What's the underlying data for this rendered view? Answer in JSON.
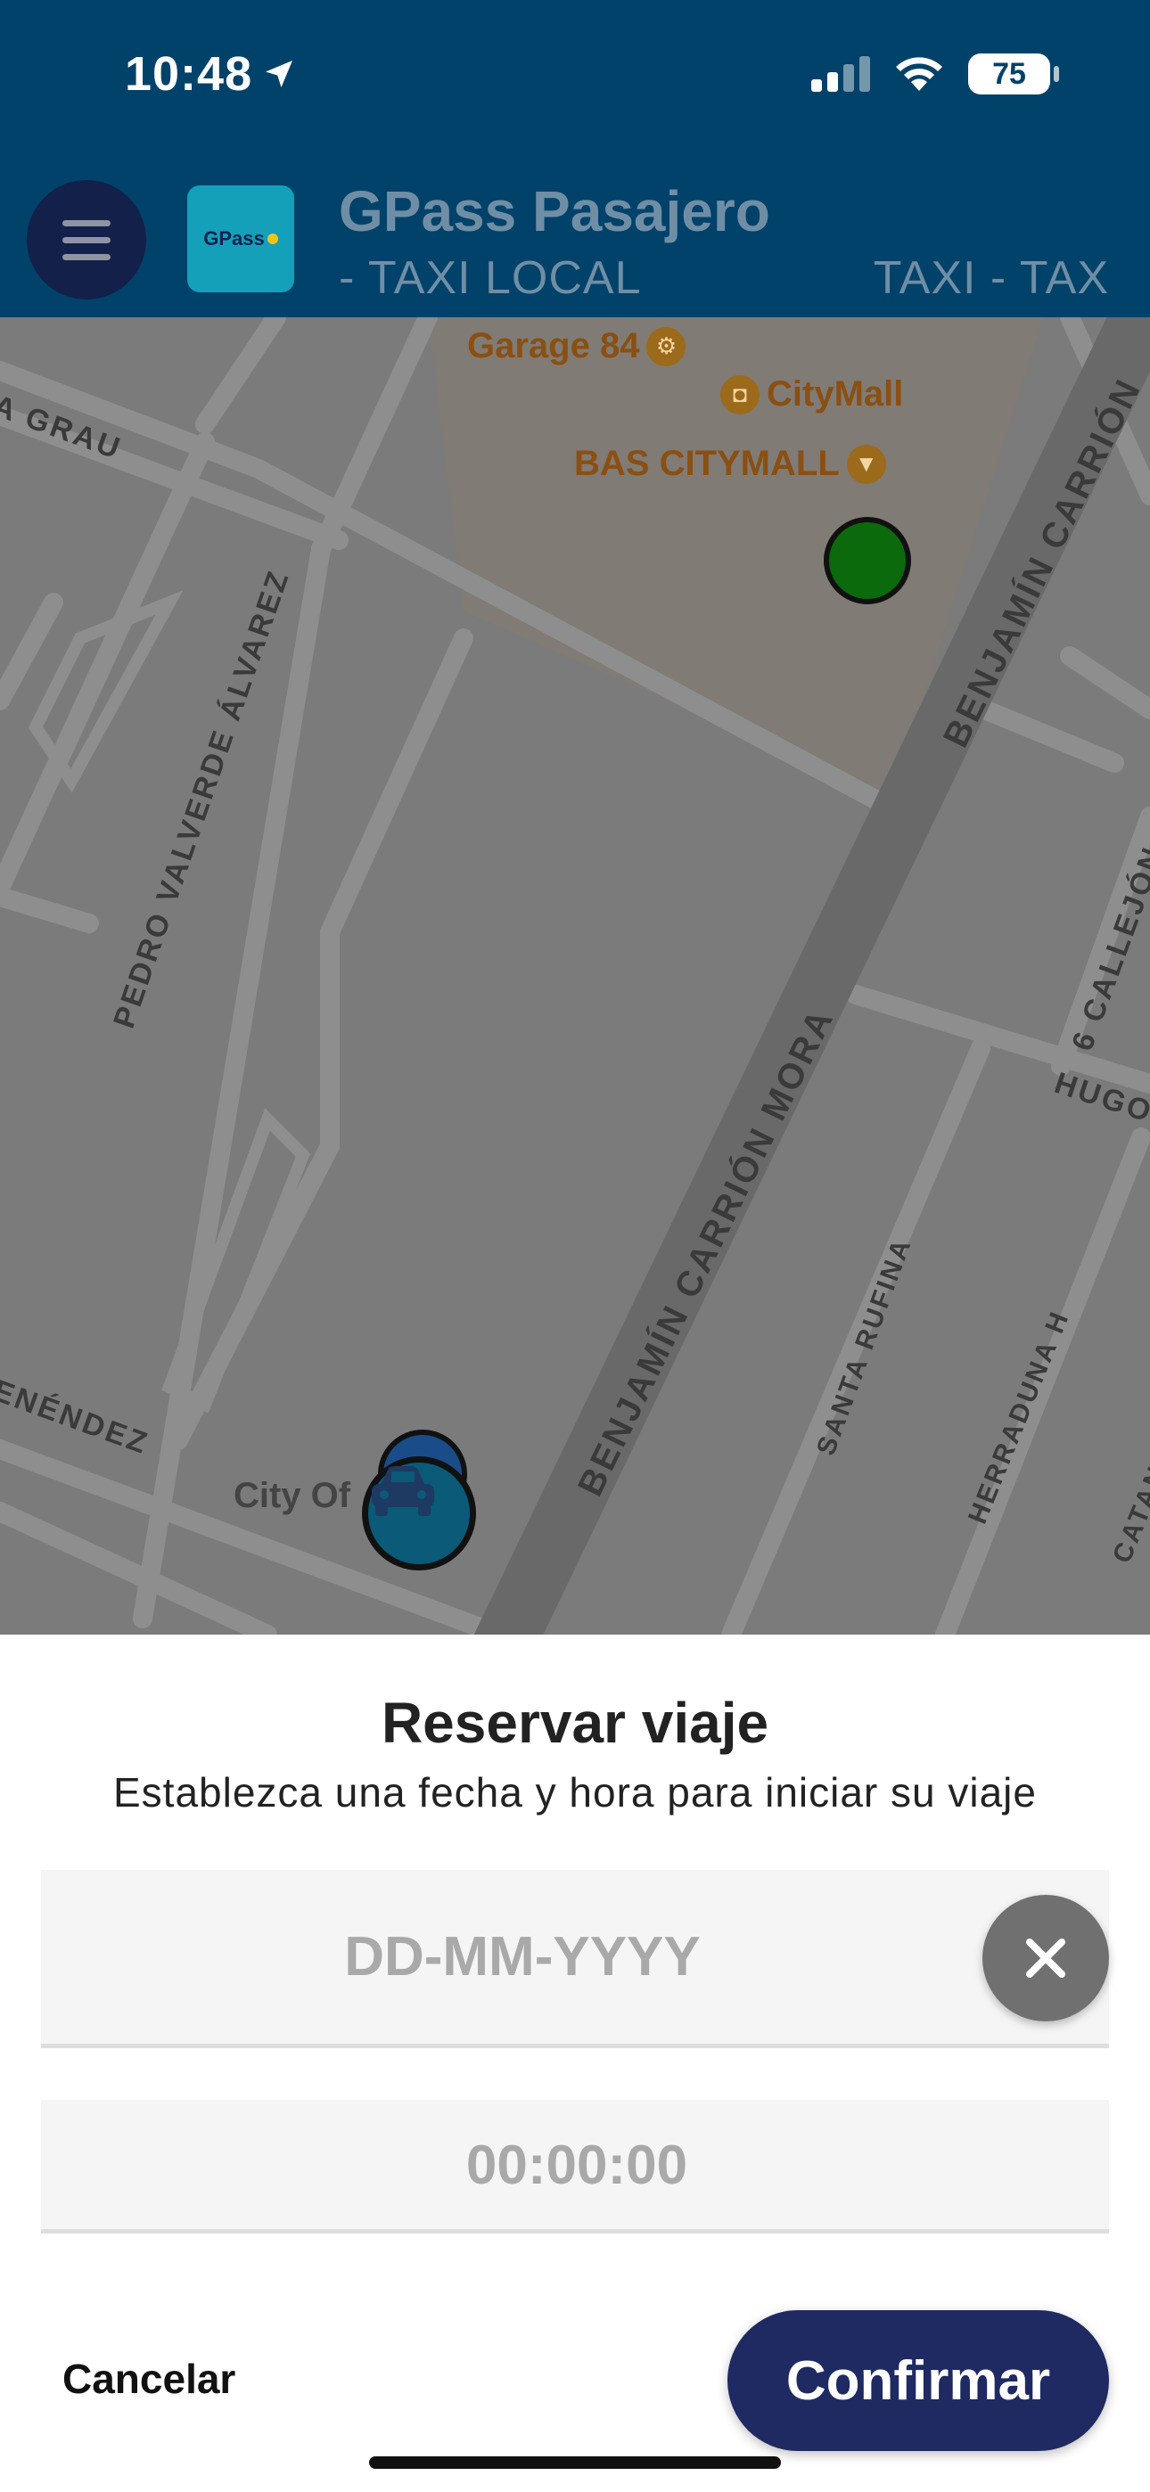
{
  "status_bar": {
    "time": "10:48",
    "battery": "75"
  },
  "header": {
    "logo_text": "GPass",
    "title": "GPass Pasajero",
    "subtitle": "- TAXI LOCAL",
    "subtitle_right": "TAXI - TAX"
  },
  "map": {
    "pois": [
      "Garage 84",
      "CityMall",
      "BAS CITYMALL"
    ],
    "streets": [
      "A GRAU",
      "PEDRO VALVERDE ÁLVAREZ",
      "BENJAMÍN CARRIÓN MORA",
      "BENJAMÍN CARRIÓN",
      "6 CALLEJÓN",
      "HUGO",
      "ENÉNDEZ",
      "SANTA RUFINA",
      "HERRADUNA H",
      "CATAN"
    ],
    "city_label": "City Of",
    "colors": {
      "pickup_marker": "#0b6a0b",
      "car_marker": "#0a5a78",
      "user_marker": "#1a4c8a"
    }
  },
  "sheet": {
    "title": "Reservar viaje",
    "subtitle": "Establezca una fecha y hora para iniciar su viaje",
    "date_placeholder": "DD-MM-YYYY",
    "time_placeholder": "00:00:00",
    "cancel_label": "Cancelar",
    "confirm_label": "Confirmar"
  },
  "colors": {
    "header_bg": "#01426a",
    "confirm_bg": "#1f2a62"
  }
}
